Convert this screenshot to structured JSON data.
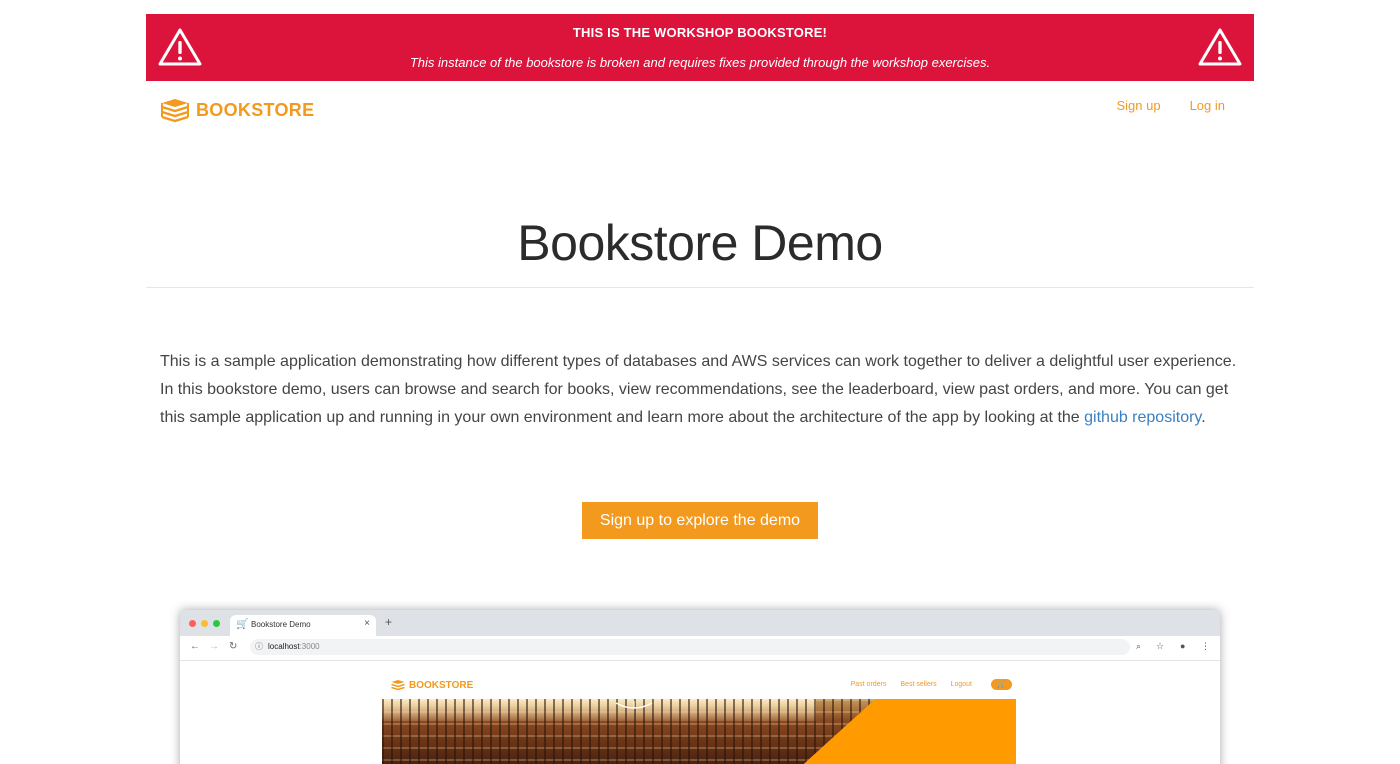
{
  "banner": {
    "title": "THIS IS THE WORKSHOP BOOKSTORE!",
    "subtitle": "This instance of the bookstore is broken and requires fixes provided through the workshop exercises.",
    "background": "#dc143c"
  },
  "navbar": {
    "brand": "BOOKSTORE",
    "links": [
      "Sign up",
      "Log in"
    ],
    "accent": "#f39a1e"
  },
  "hero": {
    "title": "Bookstore Demo",
    "description": "This is a sample application demonstrating how different types of databases and AWS services can work together to deliver a delightful user experience. In this bookstore demo, users can browse and search for books, view recommendations, see the leaderboard, view past orders, and more. You can get this sample application up and running in your own environment and learn more about the architecture of the app by looking at the ",
    "link_text": "github repository",
    "link_suffix": ".",
    "cta": "Sign up to explore the demo"
  },
  "screenshot": {
    "tab_title": "Bookstore Demo",
    "url_host": "localhost",
    "url_port": ":3000",
    "inner_brand": "BOOKSTORE",
    "inner_links": [
      "Past orders",
      "Best sellers",
      "Logout"
    ]
  },
  "icons": {
    "warning": "warning-triangle-icon",
    "brand": "books-stack-icon",
    "cart": "cart-icon"
  }
}
